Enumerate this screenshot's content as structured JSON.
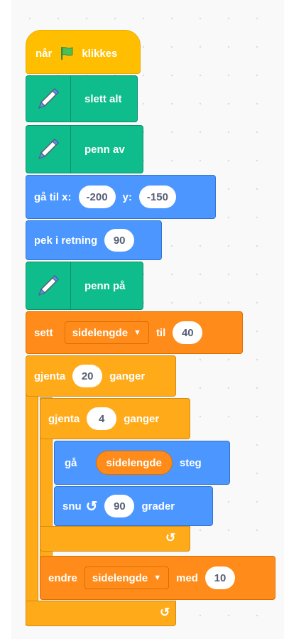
{
  "blocks": {
    "when_flag": {
      "prefix": "når",
      "suffix": "klikkes"
    },
    "clear": {
      "label": "slett alt"
    },
    "pen_up": {
      "label": "penn av"
    },
    "goto": {
      "label": "gå til x:",
      "x_value": "-200",
      "y_label": "y:",
      "y_value": "-150"
    },
    "point": {
      "label": "pek i retning",
      "value": "90"
    },
    "pen_down": {
      "label": "penn på"
    },
    "set_var": {
      "label": "sett",
      "variable": "sidelengde",
      "to_label": "til",
      "value": "40"
    },
    "repeat_outer": {
      "label": "gjenta",
      "value": "20",
      "suffix": "ganger"
    },
    "repeat_inner": {
      "label": "gjenta",
      "value": "4",
      "suffix": "ganger"
    },
    "move": {
      "label": "gå",
      "reporter": "sidelengde",
      "suffix": "steg"
    },
    "turn": {
      "label": "snu",
      "value": "90",
      "suffix": "grader"
    },
    "change_var": {
      "label": "endre",
      "variable": "sidelengde",
      "with_label": "med",
      "value": "10"
    }
  },
  "icons": {
    "flag": "green-flag-icon",
    "pen": "pen-extension-icon",
    "turn": "rotate-left-icon",
    "loop": "loop-arrow-icon",
    "dropdown": "dropdown-caret-icon"
  },
  "colors": {
    "events": "#ffbf00",
    "pen": "#0fbd8c",
    "motion": "#4c97ff",
    "variables": "#ff8c1a",
    "control": "#ffab19"
  }
}
